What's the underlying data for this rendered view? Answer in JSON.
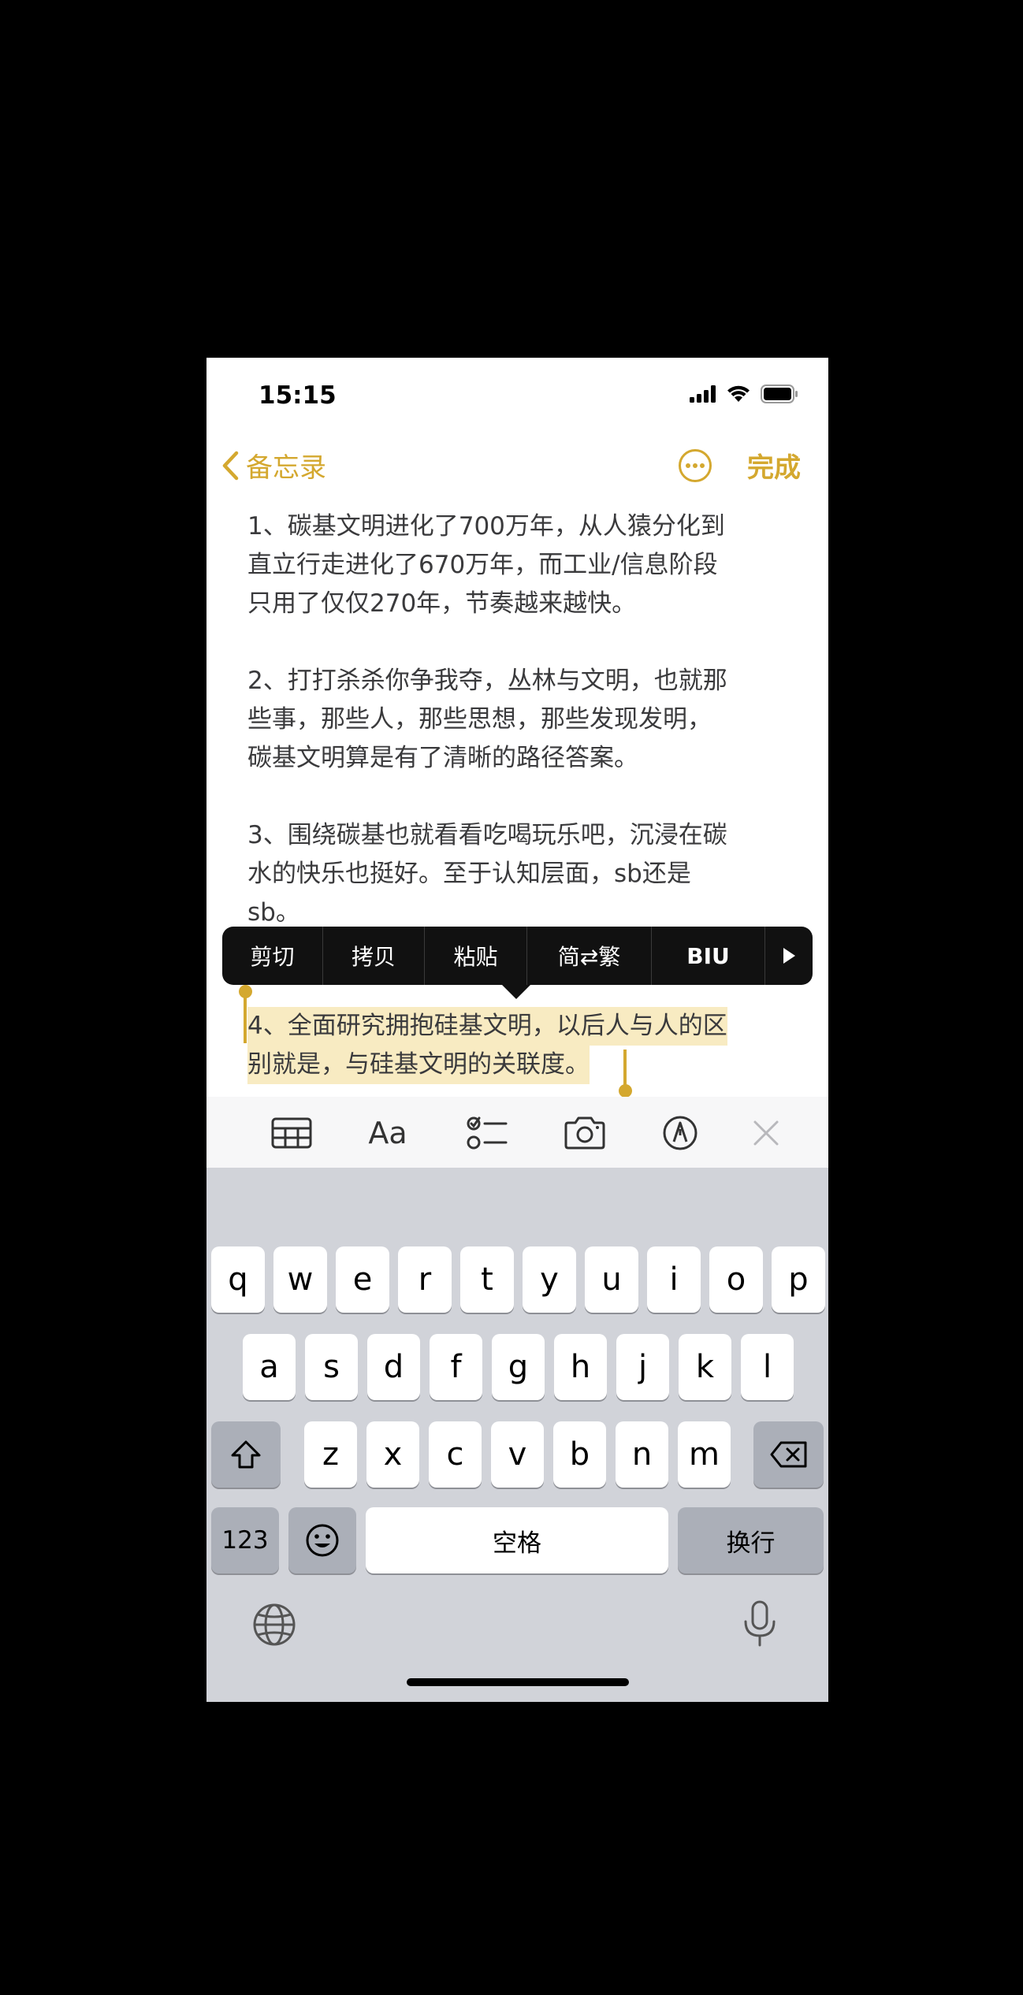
{
  "status": {
    "time": "15:15"
  },
  "nav": {
    "back_label": "备忘录",
    "done_label": "完成"
  },
  "note": {
    "paragraphs": [
      [
        "1、碳基文明进化了700万年，从人猿分化到",
        "直立行走进化了670万年，而工业/信息阶段",
        "只用了仅仅270年，节奏越来越快。"
      ],
      [
        "2、打打杀杀你争我夺，丛林与文明，也就那",
        "些事，那些人，那些思想，那些发现发明，",
        "碳基文明算是有了清晰的路径答案。"
      ],
      [
        "3、围绕碳基也就看看吃喝玩乐吧，沉浸在碳",
        "水的快乐也挺好。至于认知层面，sb还是",
        "sb。"
      ]
    ],
    "selected": [
      "4、全面研究拥抱硅基文明，以后人与人的区",
      "别就是，与硅基文明的关联度。"
    ]
  },
  "edit_menu": {
    "cut": "剪切",
    "copy": "拷贝",
    "paste": "粘贴",
    "convert": "简⇄繁",
    "format": "BIU"
  },
  "toolbar": {
    "icons": [
      "table-icon",
      "text-format-icon",
      "checklist-icon",
      "camera-icon",
      "markup-icon",
      "close-icon"
    ],
    "format_label": "Aa"
  },
  "keyboard": {
    "row1": [
      "q",
      "w",
      "e",
      "r",
      "t",
      "y",
      "u",
      "i",
      "o",
      "p"
    ],
    "row2": [
      "a",
      "s",
      "d",
      "f",
      "g",
      "h",
      "j",
      "k",
      "l"
    ],
    "row3": [
      "z",
      "x",
      "c",
      "v",
      "b",
      "n",
      "m"
    ],
    "numbers_label": "123",
    "space_label": "空格",
    "return_label": "换行"
  },
  "colors": {
    "accent": "#d4a82f",
    "selection": "#f8ebc2",
    "keyboard_bg": "#d1d3d9"
  }
}
